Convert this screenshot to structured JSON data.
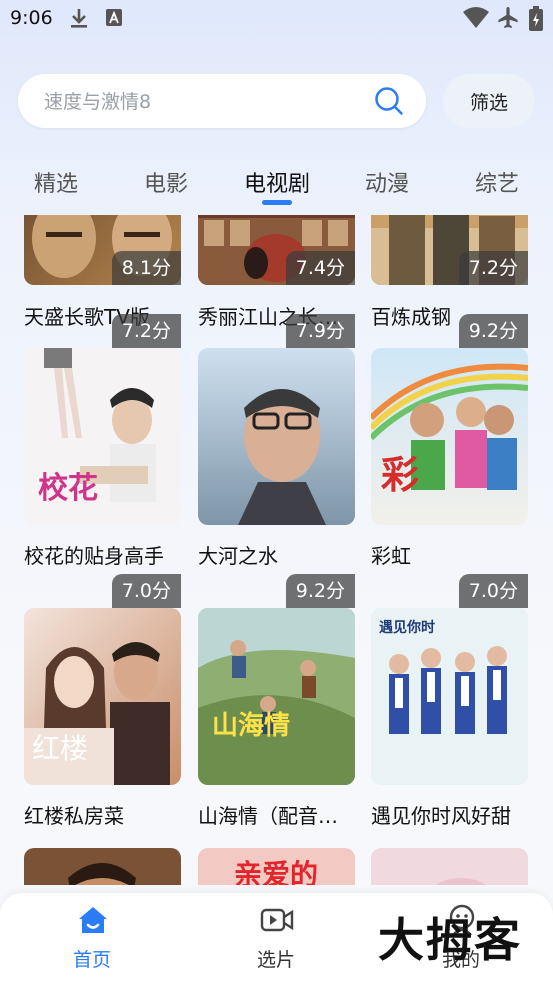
{
  "status_bar": {
    "time": "9:06"
  },
  "search": {
    "placeholder": "速度与激情8",
    "filter_label": "筛选"
  },
  "tabs": [
    {
      "label": "精选"
    },
    {
      "label": "电影"
    },
    {
      "label": "电视剧",
      "active": true
    },
    {
      "label": "动漫"
    },
    {
      "label": "综艺"
    }
  ],
  "cards": [
    {
      "title": "天盛长歌TV版",
      "rating": "8.1分"
    },
    {
      "title": "秀丽江山之长…",
      "rating": "7.4分"
    },
    {
      "title": "百炼成钢",
      "rating": "7.2分"
    },
    {
      "title": "校花的贴身高手",
      "rating": "7.2分"
    },
    {
      "title": "大河之水",
      "rating": "7.9分"
    },
    {
      "title": "彩虹",
      "rating": "9.2分"
    },
    {
      "title": "红楼私房菜",
      "rating": "7.0分"
    },
    {
      "title": "山海情（配音…",
      "rating": "9.2分"
    },
    {
      "title": "遇见你时风好甜",
      "rating": "7.0分"
    },
    {
      "title": "",
      "rating": ""
    },
    {
      "title": "",
      "rating": ""
    },
    {
      "title": "",
      "rating": ""
    }
  ],
  "bottom_nav": [
    {
      "label": "首页",
      "icon": "home-icon",
      "active": true
    },
    {
      "label": "选片",
      "icon": "video-icon"
    },
    {
      "label": "我的",
      "icon": "profile-icon"
    }
  ],
  "watermark": {
    "text": "大拇客"
  },
  "colors": {
    "accent": "#2b7cf6",
    "rating_bg": "#3c3c3c"
  }
}
